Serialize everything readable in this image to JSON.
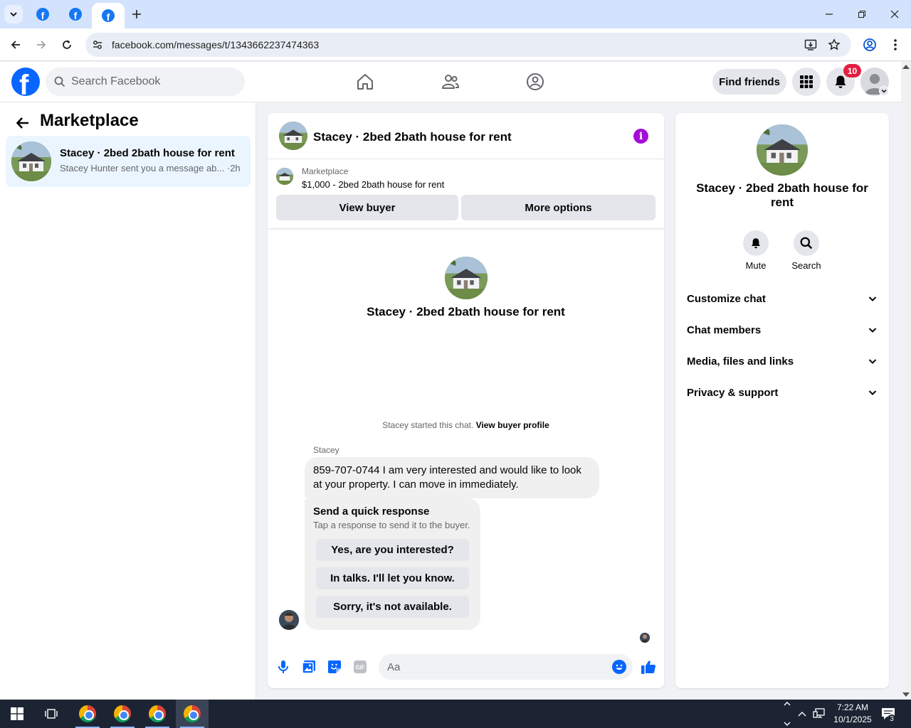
{
  "browser": {
    "tabs": [
      {
        "icon": "facebook-favicon",
        "active": false
      },
      {
        "icon": "facebook-favicon",
        "active": false
      },
      {
        "icon": "facebook-favicon",
        "active": true
      }
    ],
    "url": "facebook.com/messages/t/1343662237474363"
  },
  "header": {
    "search_placeholder": "Search Facebook",
    "find_friends_label": "Find friends",
    "notifications_count": "10"
  },
  "left_panel": {
    "title": "Marketplace",
    "conversations": [
      {
        "name": "Stacey · 2bed 2bath house for rent",
        "snippet": "Stacey Hunter sent you a message ab...",
        "time": " ·2h"
      }
    ]
  },
  "chat": {
    "title": "Stacey · 2bed 2bath house for rent",
    "marketplace_label": "Marketplace",
    "listing": "$1,000 - 2bed 2bath house for rent",
    "view_buyer_label": "View buyer",
    "more_options_label": "More options",
    "hero_name": "Stacey · 2bed 2bath house for rent",
    "started_text": "Stacey started this chat. ",
    "view_buyer_profile_label": "View buyer profile",
    "sender_name": "Stacey",
    "message": "859-707-0744 I am very interested and would like to look at your property. I can move in immediately.",
    "quick_response": {
      "title": "Send a quick response",
      "subtitle": "Tap a response to send it to the buyer.",
      "options": [
        "Yes, are you interested?",
        "In talks. I'll let you know.",
        "Sorry, it's not available."
      ]
    },
    "composer_placeholder": "Aa"
  },
  "right_panel": {
    "name": "Stacey · 2bed 2bath house for rent",
    "actions": [
      {
        "label": "Mute"
      },
      {
        "label": "Search"
      }
    ],
    "sections": [
      {
        "label": "Customize chat"
      },
      {
        "label": "Chat members"
      },
      {
        "label": "Media, files and links"
      },
      {
        "label": "Privacy & support"
      }
    ]
  },
  "taskbar": {
    "time": "7:22 AM",
    "date": "10/1/2025",
    "notification_count": "3"
  },
  "colors": {
    "facebook_blue": "#0866ff",
    "info_purple": "#a30ed6",
    "badge_red": "#e41e3f",
    "selected_row": "#ebf5ff"
  }
}
